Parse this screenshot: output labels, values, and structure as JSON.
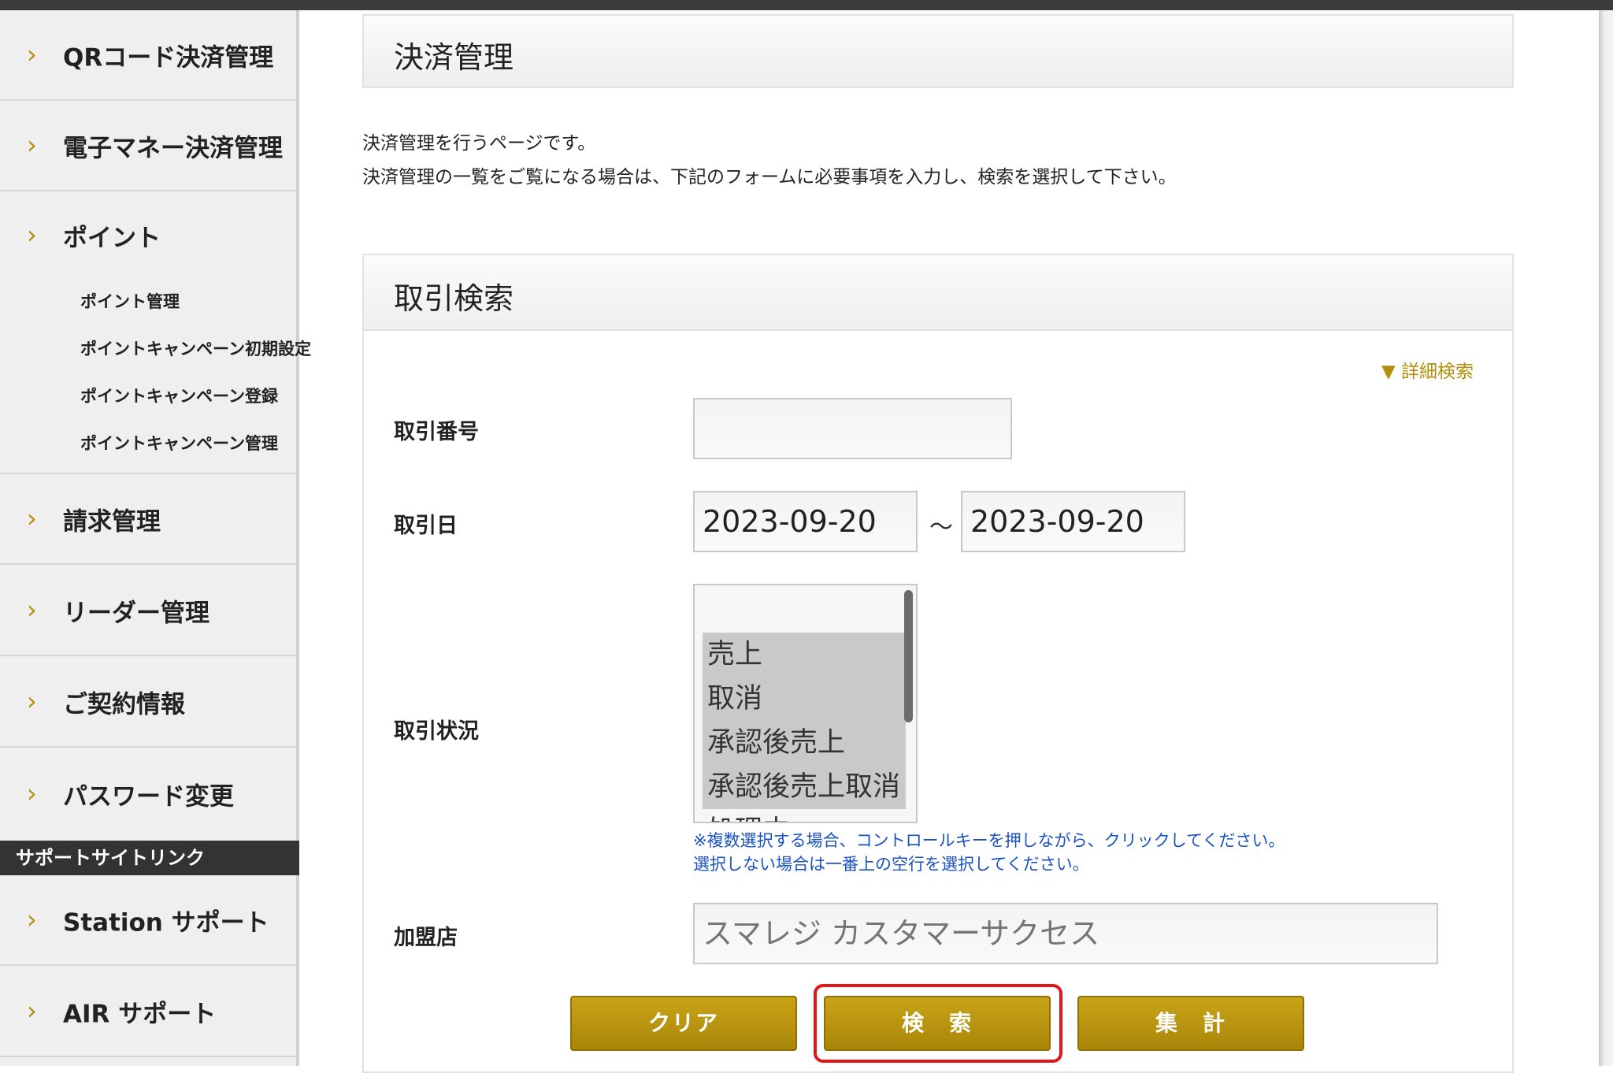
{
  "sidebar": {
    "items": [
      {
        "label": "QRコード決済管理"
      },
      {
        "label": "電子マネー決済管理"
      },
      {
        "label": "ポイント"
      },
      {
        "label": "請求管理"
      },
      {
        "label": "リーダー管理"
      },
      {
        "label": "ご契約情報"
      },
      {
        "label": "パスワード変更"
      }
    ],
    "point_submenu": [
      {
        "label": "ポイント管理"
      },
      {
        "label": "ポイントキャンペーン初期設定"
      },
      {
        "label": "ポイントキャンペーン登録"
      },
      {
        "label": "ポイントキャンペーン管理"
      }
    ],
    "support_heading": "サポートサイトリンク",
    "support_items": [
      {
        "label": "Station サポート"
      },
      {
        "label": "AIR サポート"
      }
    ]
  },
  "main": {
    "page_title": "決済管理",
    "description_line1": "決済管理を行うページです。",
    "description_line2": "決済管理の一覧をご覧になる場合は、下記のフォームに必要事項を入力し、検索を選択して下さい。",
    "search_panel": {
      "title": "取引検索",
      "detail_link": "▼ 詳細検索",
      "transaction_number": {
        "label": "取引番号",
        "value": ""
      },
      "transaction_date": {
        "label": "取引日",
        "from": "2023-09-20",
        "separator": "～",
        "to": "2023-09-20"
      },
      "transaction_status": {
        "label": "取引状況",
        "options": [
          "",
          "売上",
          "取消",
          "承認後売上",
          "承認後売上取消",
          "処理中"
        ],
        "selected": [
          "売上",
          "取消",
          "承認後売上",
          "承認後売上取消"
        ]
      },
      "hint_line1": "※複数選択する場合、コントロールキーを押しながら、クリックしてください。",
      "hint_line2": "選択しない場合は一番上の空行を選択してください。",
      "merchant": {
        "label": "加盟店",
        "placeholder": "スマレジ カスタマーサクセス"
      },
      "buttons": {
        "clear": "クリア",
        "search": "検　索",
        "aggregate": "集　計"
      }
    }
  },
  "colors": {
    "accent_gold": "#b48f0a",
    "button_gold": "#b8950f",
    "hint_blue": "#1a52c4",
    "highlight_red": "#e0161b"
  }
}
